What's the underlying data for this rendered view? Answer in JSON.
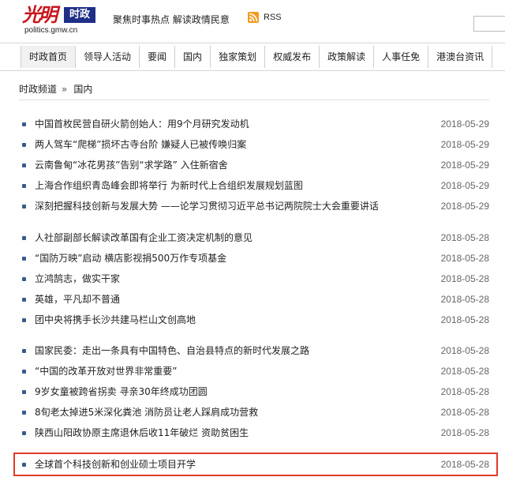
{
  "header": {
    "logo_text": "光明",
    "logo_badge": "时政",
    "logo_domain": "politics.gmw.cn",
    "slogan": "聚焦时事热点 解读政情民意",
    "rss_label": "RSS",
    "rss_icon": "rss-feed-icon"
  },
  "nav": {
    "items": [
      {
        "label": "时政首页"
      },
      {
        "label": "领导人活动"
      },
      {
        "label": "要闻"
      },
      {
        "label": "国内"
      },
      {
        "label": "独家策划"
      },
      {
        "label": "权威发布"
      },
      {
        "label": "政策解读"
      },
      {
        "label": "人事任免"
      },
      {
        "label": "港澳台资讯"
      }
    ]
  },
  "breadcrumb": {
    "channel": "时政频道",
    "separator": "»",
    "current": "国内"
  },
  "groups": [
    {
      "items": [
        {
          "title": "中国首枚民营自研火箭创始人：用9个月研究发动机",
          "date": "2018-05-29"
        },
        {
          "title": "两人驾车“爬梯”损坏古寺台阶 嫌疑人已被传唤归案",
          "date": "2018-05-29"
        },
        {
          "title": "云南鲁甸“冰花男孩”告别“求学路” 入住新宿舍",
          "date": "2018-05-29"
        },
        {
          "title": "上海合作组织青岛峰会即将举行 为新时代上合组织发展规划蓝图",
          "date": "2018-05-29"
        },
        {
          "title": "深刻把握科技创新与发展大势 ——论学习贯彻习近平总书记两院院士大会重要讲话",
          "date": "2018-05-29"
        }
      ]
    },
    {
      "items": [
        {
          "title": "人社部副部长解读改革国有企业工资决定机制的意见",
          "date": "2018-05-28"
        },
        {
          "title": "“国防万映”启动 横店影视捐500万作专项基金",
          "date": "2018-05-28"
        },
        {
          "title": "立鸿鹄志，做实干家",
          "date": "2018-05-28"
        },
        {
          "title": "英雄，平凡却不普通",
          "date": "2018-05-28"
        },
        {
          "title": "团中央将携手长沙共建马栏山文创高地",
          "date": "2018-05-28"
        }
      ]
    },
    {
      "items": [
        {
          "title": "国家民委：走出一条具有中国特色、自治县特点的新时代发展之路",
          "date": "2018-05-28"
        },
        {
          "title": "“中国的改革开放对世界非常重要”",
          "date": "2018-05-28"
        },
        {
          "title": "9岁女童被跨省拐卖 寻亲30年终成功团圆",
          "date": "2018-05-28"
        },
        {
          "title": "8旬老太掉进5米深化粪池 消防员让老人踩肩成功营救",
          "date": "2018-05-28"
        },
        {
          "title": "陕西山阳政协原主席退休后收11年破烂 资助贫困生",
          "date": "2018-05-28"
        }
      ]
    },
    {
      "items": [
        {
          "title": "全球首个科技创新和创业硕士项目开学",
          "date": "2018-05-28"
        }
      ]
    }
  ],
  "colors": {
    "brand_red": "#c8161d",
    "badge_blue": "#1f2f86",
    "highlight_border": "#e03a2a",
    "bullet": "#3a5a8c"
  }
}
